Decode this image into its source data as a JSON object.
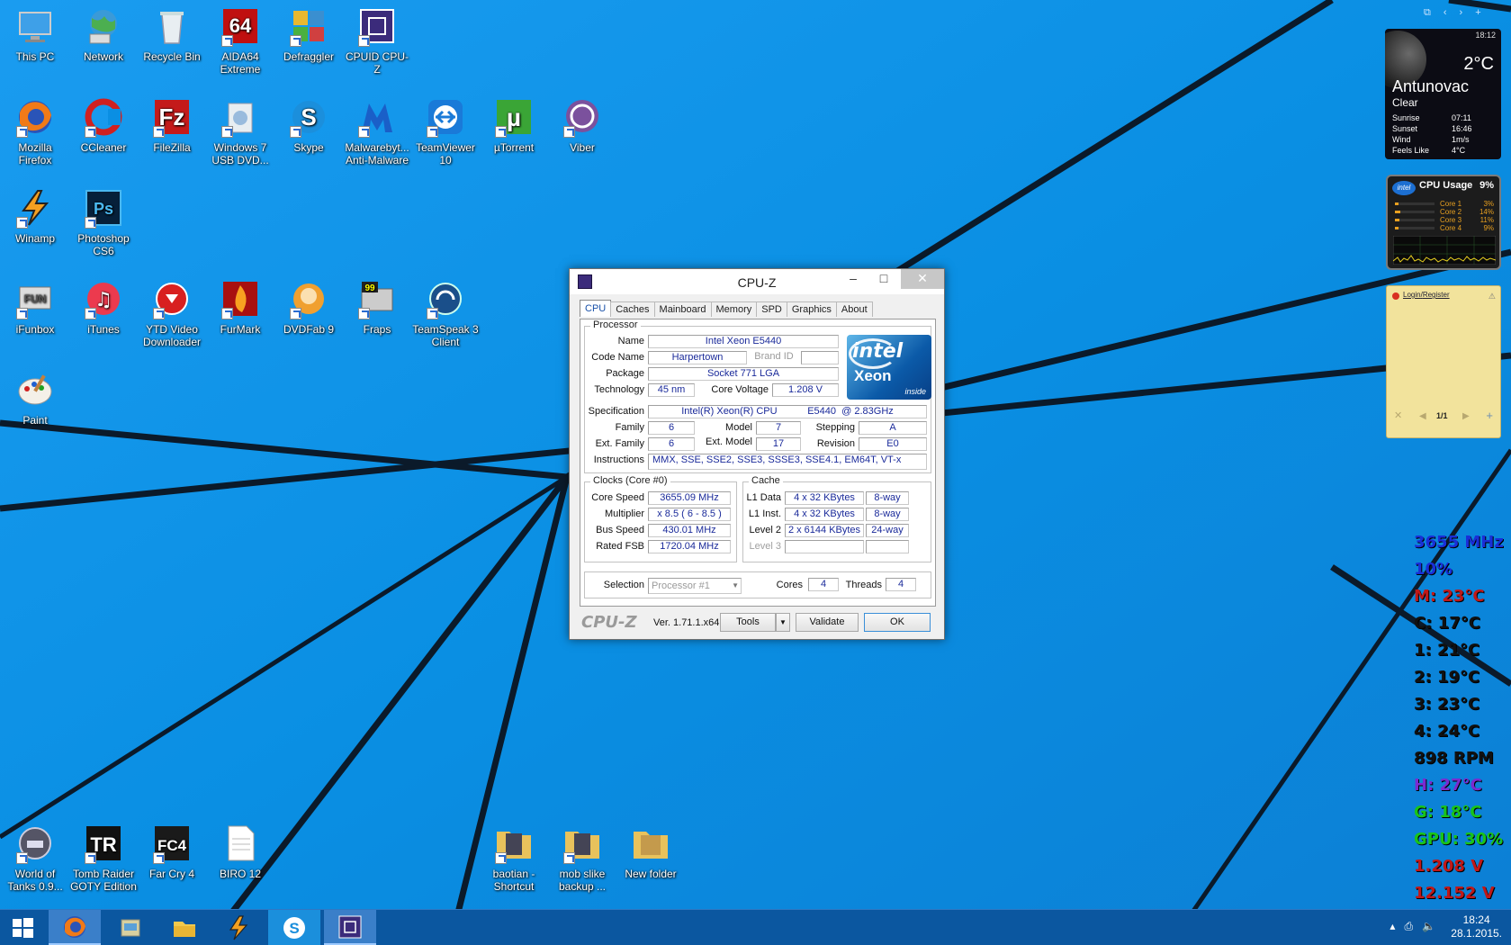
{
  "desktop_icons": [
    {
      "label": "This PC",
      "icon": "computer-icon"
    },
    {
      "label": "Network",
      "icon": "network-globe-icon"
    },
    {
      "label": "Recycle Bin",
      "icon": "recycle-bin-icon"
    },
    {
      "label": "AIDA64 Extreme",
      "icon": "aida64-icon"
    },
    {
      "label": "Defraggler",
      "icon": "defraggler-icon"
    },
    {
      "label": "CPUID CPU-Z",
      "icon": "cpuz-icon"
    },
    {
      "label": "Mozilla Firefox",
      "icon": "firefox-icon"
    },
    {
      "label": "CCleaner",
      "icon": "ccleaner-icon"
    },
    {
      "label": "FileZilla",
      "icon": "filezilla-icon"
    },
    {
      "label": "Windows 7 USB DVD...",
      "icon": "usb-dvd-tool-icon"
    },
    {
      "label": "Skype",
      "icon": "skype-icon"
    },
    {
      "label": "Malwarebyt... Anti-Malware",
      "icon": "malwarebytes-icon"
    },
    {
      "label": "TeamViewer 10",
      "icon": "teamviewer-icon"
    },
    {
      "label": "µTorrent",
      "icon": "utorrent-icon"
    },
    {
      "label": "Viber",
      "icon": "viber-icon"
    },
    {
      "label": "Winamp",
      "icon": "winamp-icon"
    },
    {
      "label": "Photoshop CS6",
      "icon": "photoshop-icon"
    },
    {
      "label": "iFunbox",
      "icon": "ifunbox-icon"
    },
    {
      "label": "iTunes",
      "icon": "itunes-icon"
    },
    {
      "label": "YTD Video Downloader",
      "icon": "ytd-downloader-icon"
    },
    {
      "label": "FurMark",
      "icon": "furmark-icon"
    },
    {
      "label": "DVDFab 9",
      "icon": "dvdfab-icon"
    },
    {
      "label": "Fraps",
      "icon": "fraps-icon"
    },
    {
      "label": "TeamSpeak 3 Client",
      "icon": "teamspeak-icon"
    },
    {
      "label": "Paint",
      "icon": "paint-icon"
    },
    {
      "label": "World of Tanks 0.9...",
      "icon": "world-of-tanks-icon"
    },
    {
      "label": "Tomb Raider GOTY Edition",
      "icon": "tomb-raider-icon"
    },
    {
      "label": "Far Cry 4",
      "icon": "far-cry-4-icon"
    },
    {
      "label": "BIRO 12",
      "icon": "text-document-icon"
    },
    {
      "label": "baotian - Shortcut",
      "icon": "folder-shortcut-icon"
    },
    {
      "label": "mob slike backup ...",
      "icon": "folder-shortcut-icon"
    },
    {
      "label": "New folder",
      "icon": "folder-icon"
    }
  ],
  "cpuz": {
    "title": "CPU-Z",
    "tabs": [
      "CPU",
      "Caches",
      "Mainboard",
      "Memory",
      "SPD",
      "Graphics",
      "About"
    ],
    "selected_tab": "CPU",
    "processor": {
      "group": "Processor",
      "name_label": "Name",
      "name": "Intel Xeon E5440",
      "codename_label": "Code Name",
      "codename": "Harpertown",
      "brandid_label": "Brand ID",
      "package_label": "Package",
      "package": "Socket 771 LGA",
      "technology_label": "Technology",
      "technology": "45 nm",
      "corevoltage_label": "Core Voltage",
      "corevoltage": "1.208 V",
      "spec_label": "Specification",
      "spec": "Intel(R) Xeon(R) CPU           E5440  @ 2.83GHz",
      "family_label": "Family",
      "family": "6",
      "model_label": "Model",
      "model": "7",
      "stepping_label": "Stepping",
      "stepping": "A",
      "extfamily_label": "Ext. Family",
      "extfamily": "6",
      "extmodel_label": "Ext. Model",
      "extmodel": "17",
      "revision_label": "Revision",
      "revision": "E0",
      "instr_label": "Instructions",
      "instructions": "MMX, SSE, SSE2, SSE3, SSSE3, SSE4.1, EM64T, VT-x",
      "logo": {
        "brand": "intel",
        "product": "Xeon",
        "tag": "inside"
      }
    },
    "clocks": {
      "group": "Clocks (Core #0)",
      "corespeed_label": "Core Speed",
      "corespeed": "3655.09 MHz",
      "multiplier_label": "Multiplier",
      "multiplier": "x 8.5 ( 6 - 8.5 )",
      "busspeed_label": "Bus Speed",
      "busspeed": "430.01 MHz",
      "ratedfsb_label": "Rated FSB",
      "ratedfsb": "1720.04 MHz"
    },
    "cache": {
      "group": "Cache",
      "l1d_label": "L1 Data",
      "l1d": "4 x 32 KBytes",
      "l1d_way": "8-way",
      "l1i_label": "L1 Inst.",
      "l1i": "4 x 32 KBytes",
      "l1i_way": "8-way",
      "l2_label": "Level 2",
      "l2": "2 x 6144 KBytes",
      "l2_way": "24-way",
      "l3_label": "Level 3"
    },
    "selection_label": "Selection",
    "selection": "Processor #1",
    "cores_label": "Cores",
    "cores": "4",
    "threads_label": "Threads",
    "threads": "4",
    "brand": "CPU-Z",
    "version": "Ver. 1.71.1.x64",
    "tools_label": "Tools",
    "validate_label": "Validate",
    "ok_label": "OK"
  },
  "weather": {
    "time": "18:12",
    "temp": "2°C",
    "city": "Antunovac",
    "condition": "Clear",
    "rows": [
      {
        "k": "Sunrise",
        "v": "07:11"
      },
      {
        "k": "Sunset",
        "v": "16:46"
      },
      {
        "k": "Wind",
        "v": "1m/s"
      },
      {
        "k": "Feels Like",
        "v": "4°C"
      }
    ]
  },
  "cpu_gadget": {
    "title": "CPU Usage",
    "total": "9%",
    "cores": [
      {
        "name": "Core 1",
        "value": "3%",
        "level": 0.03
      },
      {
        "name": "Core 2",
        "value": "14%",
        "level": 0.14
      },
      {
        "name": "Core 3",
        "value": "11%",
        "level": 0.11
      },
      {
        "name": "Core 4",
        "value": "9%",
        "level": 0.09
      }
    ]
  },
  "note_gadget": {
    "login": "Login",
    "sep": "/",
    "register": "Register",
    "pages": "1/1"
  },
  "hw_monitor": [
    {
      "text": "3655 MHz",
      "color": "#1a2ed8"
    },
    {
      "text": "10%",
      "color": "#1a2ed8"
    },
    {
      "text": "M: 23°C",
      "color": "#c01818"
    },
    {
      "text": "C: 17°C",
      "color": "#111111"
    },
    {
      "text": "1: 21°C",
      "color": "#111111"
    },
    {
      "text": "2: 19°C",
      "color": "#111111"
    },
    {
      "text": "3: 23°C",
      "color": "#111111"
    },
    {
      "text": "4: 24°C",
      "color": "#111111"
    },
    {
      "text": "898 RPM",
      "color": "#111111"
    },
    {
      "text": "H: 27°C",
      "color": "#7a2ad0"
    },
    {
      "text": "G: 18°C",
      "color": "#19c419"
    },
    {
      "text": "GPU: 30%",
      "color": "#19c419"
    },
    {
      "text": "1.208 V",
      "color": "#c01818"
    },
    {
      "text": "12.152 V",
      "color": "#c01818"
    }
  ],
  "taskbar": {
    "items": [
      "start-button",
      "firefox-icon",
      "file-transfer-icon",
      "file-explorer-icon",
      "winamp-icon",
      "skype-icon",
      "cpuz-icon"
    ],
    "time": "18:24",
    "date": "28.1.2015."
  }
}
